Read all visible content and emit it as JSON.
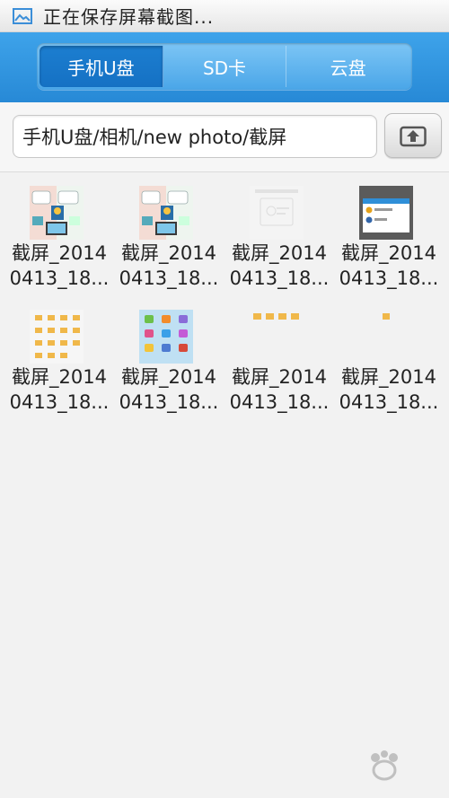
{
  "status": {
    "icon": "image-icon",
    "text": "正在保存屏幕截图..."
  },
  "tabs": [
    {
      "label": "手机U盘",
      "active": true
    },
    {
      "label": "SD卡",
      "active": false
    },
    {
      "label": "云盘",
      "active": false
    }
  ],
  "path": {
    "value": "手机U盘/相机/new photo/截屏",
    "upload_icon": "upload-icon"
  },
  "files": [
    {
      "line1": "截屏_2014",
      "line2": "0413_18...",
      "thumb": "photo-collage"
    },
    {
      "line1": "截屏_2014",
      "line2": "0413_18...",
      "thumb": "photo-collage"
    },
    {
      "line1": "截屏_2014",
      "line2": "0413_18...",
      "thumb": "faint-dialog"
    },
    {
      "line1": "截屏_2014",
      "line2": "0413_18...",
      "thumb": "dark-app"
    },
    {
      "line1": "截屏_2014",
      "line2": "0413_18...",
      "thumb": "folder-grid"
    },
    {
      "line1": "截屏_2014",
      "line2": "0413_18...",
      "thumb": "app-icons"
    },
    {
      "line1": "截屏_2014",
      "line2": "0413_18...",
      "thumb": "folder-row"
    },
    {
      "line1": "截屏_2014",
      "line2": "0413_18...",
      "thumb": "single-folder"
    }
  ],
  "colors": {
    "header_blue": "#2b8fdb",
    "active_tab": "#1876c9"
  }
}
